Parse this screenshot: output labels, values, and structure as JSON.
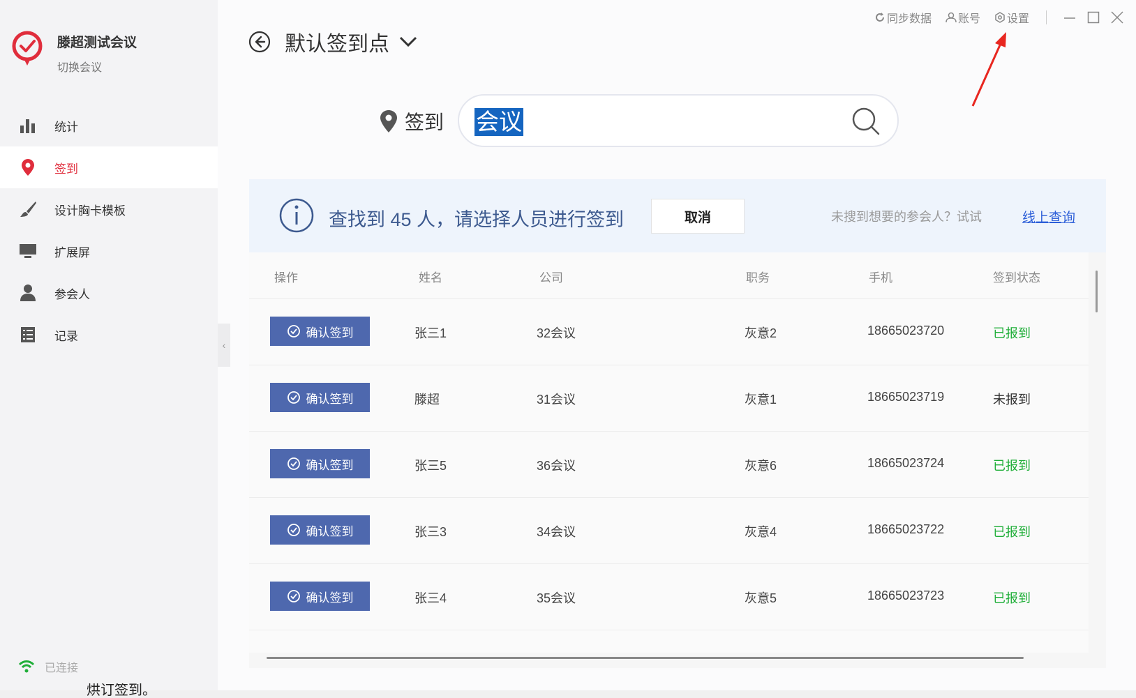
{
  "app": {
    "meeting_name": "滕超测试会议",
    "switch_meeting": "切换会议",
    "brand_color": "#e02d3c"
  },
  "topbar": {
    "sync": "同步数据",
    "account": "账号",
    "settings": "设置"
  },
  "sidebar": {
    "items": [
      {
        "label": "统计",
        "icon": "bar-chart-icon",
        "active": false
      },
      {
        "label": "签到",
        "icon": "location-pin-icon",
        "active": true
      },
      {
        "label": "设计胸卡模板",
        "icon": "brush-icon",
        "active": false
      },
      {
        "label": "扩展屏",
        "icon": "monitor-icon",
        "active": false
      },
      {
        "label": "参会人",
        "icon": "person-icon",
        "active": false
      },
      {
        "label": "记录",
        "icon": "list-icon",
        "active": false
      }
    ],
    "status": "已连接",
    "status_color": "#1fae38"
  },
  "header": {
    "title": "默认签到点"
  },
  "search": {
    "label": "签到",
    "value": "会议"
  },
  "result": {
    "message": "查找到 45 人，请选择人员进行签到",
    "cancel_label": "取消",
    "hint": "未搜到想要的参会人？试试",
    "link": "线上查询"
  },
  "table": {
    "headers": [
      "操作",
      "姓名",
      "公司",
      "职务",
      "手机",
      "签到状态"
    ],
    "action_label": "确认签到",
    "rows": [
      {
        "name": "张三1",
        "company": "32会议",
        "position": "灰意2",
        "phone": "18665023720",
        "status": "已报到",
        "checked": true
      },
      {
        "name": "滕超",
        "company": "31会议",
        "position": "灰意1",
        "phone": "18665023719",
        "status": "未报到",
        "checked": false
      },
      {
        "name": "张三5",
        "company": "36会议",
        "position": "灰意6",
        "phone": "18665023724",
        "status": "已报到",
        "checked": true
      },
      {
        "name": "张三3",
        "company": "34会议",
        "position": "灰意4",
        "phone": "18665023722",
        "status": "已报到",
        "checked": true
      },
      {
        "name": "张三4",
        "company": "35会议",
        "position": "灰意5",
        "phone": "18665023723",
        "status": "已报到",
        "checked": true
      }
    ]
  },
  "footer_text": "烘订签到。"
}
